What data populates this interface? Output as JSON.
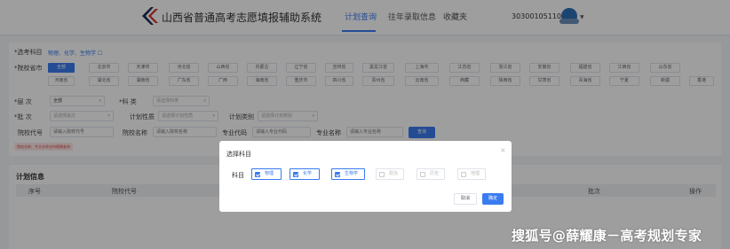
{
  "header": {
    "site_title": "山西省普通高考志愿填报辅助系统",
    "tabs": [
      {
        "label": "计划查询",
        "active": true
      },
      {
        "label": "往年录取信息",
        "active": false
      },
      {
        "label": "收藏夹",
        "active": false
      }
    ],
    "user_id": "30300105110001",
    "accent_color": "#3a7bf0"
  },
  "filters": {
    "subject_label": "*选考科目",
    "subject_value": "物理、化学、生物学",
    "province_label": "*院校省市",
    "provinces": [
      "全部",
      "北京市",
      "天津市",
      "河北省",
      "山西省",
      "内蒙古",
      "辽宁省",
      "吉林省",
      "黑龙江省",
      "上海市",
      "江苏省",
      "浙江省",
      "安徽省",
      "福建省",
      "江西省",
      "山东省",
      "河南省",
      "湖北省",
      "湖南省",
      "广东省",
      "广西",
      "海南省",
      "重庆市",
      "四川省",
      "贵州省",
      "云南省",
      "西藏",
      "陕西省",
      "甘肃省",
      "青海省",
      "宁夏",
      "新疆",
      "香港"
    ],
    "selected_province": "全部",
    "category_label": "*层 次",
    "category_value": "全部",
    "subject_type_label": "*科 类",
    "subject_type_placeholder": "请选择科类",
    "batch_label": "*批 次",
    "batch_placeholder": "请选择批次",
    "plan_nature_label": "计划性质",
    "plan_nature_placeholder": "请选择计划性质",
    "plan_type_label": "计划类别",
    "plan_type_placeholder": "请选择计划类别",
    "school_code_label": "院校代号",
    "school_code_placeholder": "请输入院校代号",
    "school_name_label": "院校名称",
    "school_name_placeholder": "请输入院校名称",
    "major_code_label": "专业代码",
    "major_code_placeholder": "请输入专业代码",
    "major_name_label": "专业名称",
    "major_name_placeholder": "请输入专业名称",
    "query_button": "查询",
    "hint": "院校名称、专业名称支持模糊查询"
  },
  "plan_info": {
    "title": "计划信息",
    "columns": [
      "序号",
      "院校代号",
      "批次",
      "操作"
    ]
  },
  "modal": {
    "title": "选择科目",
    "close_icon": "close-icon",
    "subject_label": "科目",
    "options": [
      {
        "label": "物理",
        "checked": true,
        "disabled": false
      },
      {
        "label": "化学",
        "checked": true,
        "disabled": false
      },
      {
        "label": "生物学",
        "checked": true,
        "disabled": false
      },
      {
        "label": "政治",
        "checked": false,
        "disabled": true
      },
      {
        "label": "历史",
        "checked": false,
        "disabled": true
      },
      {
        "label": "地理",
        "checked": false,
        "disabled": true
      }
    ],
    "cancel": "取消",
    "confirm": "确定"
  },
  "watermark": "搜狐号@薛耀康－高考规划专家"
}
